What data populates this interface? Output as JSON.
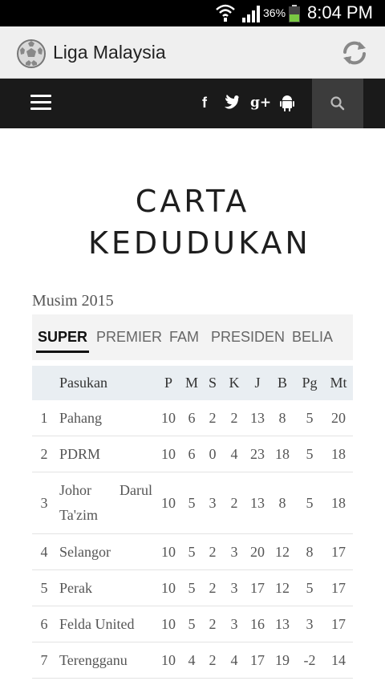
{
  "status_bar": {
    "battery": "36%",
    "time": "8:04 PM"
  },
  "app": {
    "title": "Liga Malaysia"
  },
  "nav": {
    "social": [
      "f",
      "t",
      "g+",
      "android"
    ]
  },
  "page": {
    "title": "CARTA KEDUDUKAN",
    "season": "Musim 2015"
  },
  "tabs": [
    "SUPER",
    "PREMIER",
    "FAM",
    "PRESIDEN",
    "BELIA"
  ],
  "active_tab": "SUPER",
  "table": {
    "columns": [
      "",
      "Pasukan",
      "P",
      "M",
      "S",
      "K",
      "J",
      "B",
      "Pg",
      "Mt"
    ],
    "rows": [
      [
        "1",
        "Pahang",
        "10",
        "6",
        "2",
        "2",
        "13",
        "8",
        "5",
        "20"
      ],
      [
        "2",
        "PDRM",
        "10",
        "6",
        "0",
        "4",
        "23",
        "18",
        "5",
        "18"
      ],
      [
        "3",
        "Johor Darul Ta'zim",
        "10",
        "5",
        "3",
        "2",
        "13",
        "8",
        "5",
        "18"
      ],
      [
        "4",
        "Selangor",
        "10",
        "5",
        "2",
        "3",
        "20",
        "12",
        "8",
        "17"
      ],
      [
        "5",
        "Perak",
        "10",
        "5",
        "2",
        "3",
        "17",
        "12",
        "5",
        "17"
      ],
      [
        "6",
        "Felda United",
        "10",
        "5",
        "2",
        "3",
        "16",
        "13",
        "3",
        "17"
      ],
      [
        "7",
        "Terengganu",
        "10",
        "4",
        "2",
        "4",
        "17",
        "19",
        "-2",
        "14"
      ]
    ]
  },
  "colors": {
    "navbar": "#1a1a1a",
    "search_bg": "#3c3c3c",
    "appbar": "#efefef",
    "table_header": "#e9eef2",
    "battery": "#7ac943"
  }
}
